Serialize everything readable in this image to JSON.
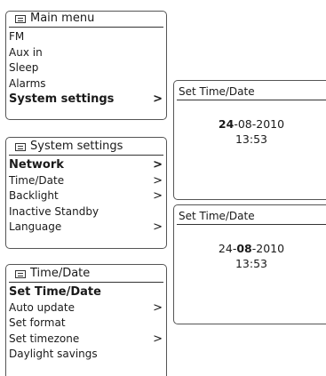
{
  "main_menu": {
    "title": "Main menu",
    "items": [
      {
        "label": "FM",
        "chevron": "",
        "selected": false
      },
      {
        "label": "Aux in",
        "chevron": "",
        "selected": false
      },
      {
        "label": "Sleep",
        "chevron": "",
        "selected": false
      },
      {
        "label": "Alarms",
        "chevron": "",
        "selected": false
      },
      {
        "label": "System settings",
        "chevron": ">",
        "selected": true
      }
    ]
  },
  "system_settings": {
    "title": "System settings",
    "items": [
      {
        "label": "Network",
        "chevron": ">",
        "selected": true
      },
      {
        "label": "Time/Date",
        "chevron": ">",
        "selected": false
      },
      {
        "label": "Backlight",
        "chevron": ">",
        "selected": false
      },
      {
        "label": "Inactive Standby",
        "chevron": "",
        "selected": false
      },
      {
        "label": "Language",
        "chevron": ">",
        "selected": false
      }
    ]
  },
  "time_date_menu": {
    "title": "Time/Date",
    "items": [
      {
        "label": "Set Time/Date",
        "chevron": "",
        "selected": true
      },
      {
        "label": "Auto update",
        "chevron": ">",
        "selected": false
      },
      {
        "label": "Set format",
        "chevron": "",
        "selected": false
      },
      {
        "label": "Set timezone",
        "chevron": ">",
        "selected": false
      },
      {
        "label": "Daylight savings",
        "chevron": "",
        "selected": false
      }
    ]
  },
  "set_time_day": {
    "title": "Set Time/Date",
    "day": "24",
    "sep1": "-",
    "month": "08",
    "sep2": "-",
    "year": "2010",
    "time": "13:53",
    "highlighted": "day"
  },
  "set_time_month": {
    "title": "Set Time/Date",
    "day": "24",
    "sep1": "-",
    "month": "08",
    "sep2": "-",
    "year": "2010",
    "time": "13:53",
    "highlighted": "month"
  },
  "icons": {
    "menu_icon": "list-menu-icon"
  }
}
